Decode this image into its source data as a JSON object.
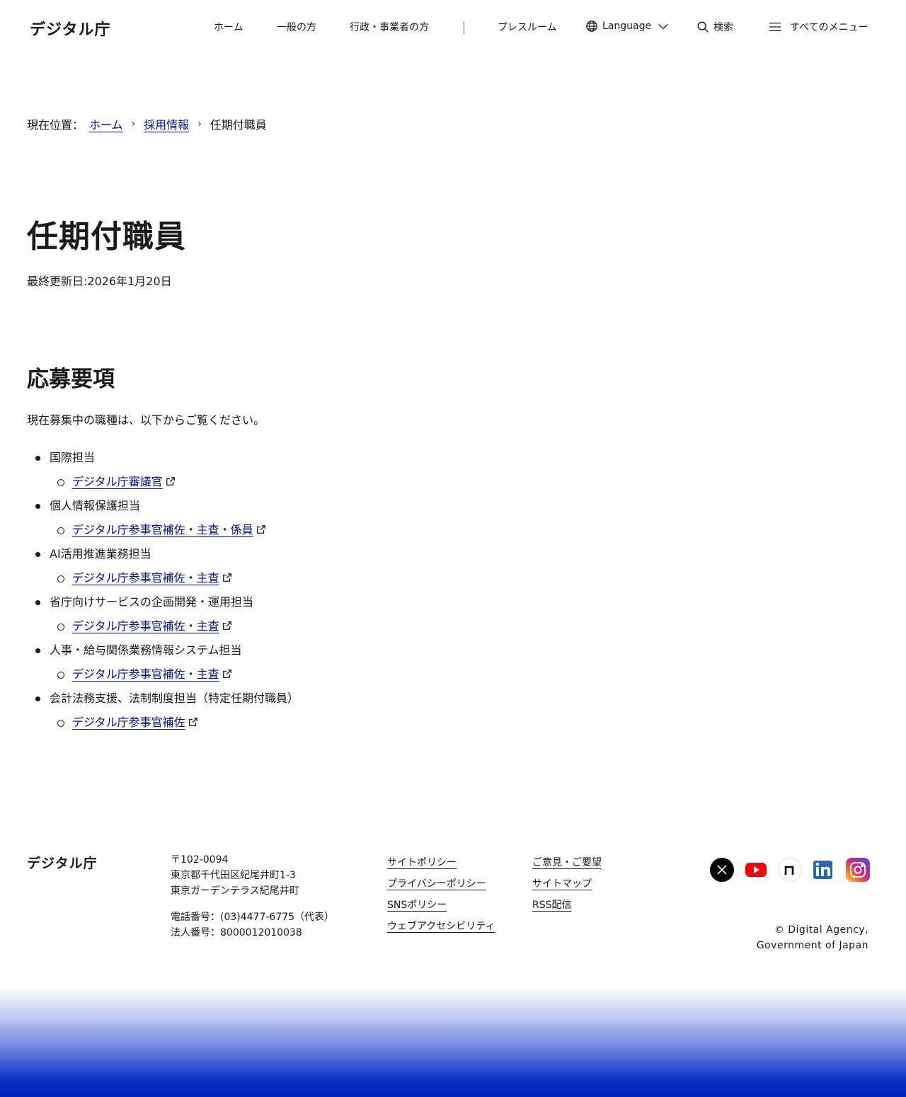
{
  "header": {
    "logo": "デジタル庁",
    "nav": {
      "home": "ホーム",
      "general": "一般の方",
      "government": "行政・事業者の方",
      "pressroom": "プレスルーム",
      "language": "Language",
      "search": "検索",
      "all_menu": "すべてのメニュー"
    }
  },
  "breadcrumb": {
    "prefix": "現在位置：",
    "items": [
      "ホーム",
      "採用情報"
    ],
    "current": "任期付職員"
  },
  "page": {
    "title": "任期付職員",
    "updated": "最終更新日:2026年1月20日"
  },
  "section": {
    "title": "応募要項",
    "intro": "現在募集中の職種は、以下からご覧ください。",
    "jobs": [
      {
        "category": "国際担当",
        "link": "デジタル庁審議官"
      },
      {
        "category": "個人情報保護担当",
        "link": "デジタル庁参事官補佐・主査・係員"
      },
      {
        "category": "AI活用推進業務担当",
        "link": "デジタル庁参事官補佐・主査"
      },
      {
        "category": "省庁向けサービスの企画開発・運用担当",
        "link": "デジタル庁参事官補佐・主査"
      },
      {
        "category": "人事・給与関係業務情報システム担当",
        "link": "デジタル庁参事官補佐・主査"
      },
      {
        "category": "会計法務支援、法制制度担当（特定任期付職員）",
        "link": "デジタル庁参事官補佐"
      }
    ]
  },
  "footer": {
    "logo": "デジタル庁",
    "postal": "〒102-0094",
    "address1": "東京都千代田区紀尾井町1-3",
    "address2": "東京ガーデンテラス紀尾井町",
    "phone": "電話番号：(03)4477-6775（代表）",
    "corp_number": "法人番号：8000012010038",
    "links_col1": [
      "サイトポリシー",
      "プライバシーポリシー",
      "SNSポリシー",
      "ウェブアクセシビリティ"
    ],
    "links_col2": [
      "ご意見・ご要望",
      "サイトマップ",
      "RSS配信"
    ],
    "social": [
      "x-icon",
      "youtube-icon",
      "note-icon",
      "linkedin-icon",
      "instagram-icon"
    ],
    "copyright_line1": "© Digital Agency,",
    "copyright_line2": "Government of Japan"
  },
  "colors": {
    "link": "#00118f",
    "text": "#1a1a1a",
    "gradient_bottom": "#0023b8"
  }
}
